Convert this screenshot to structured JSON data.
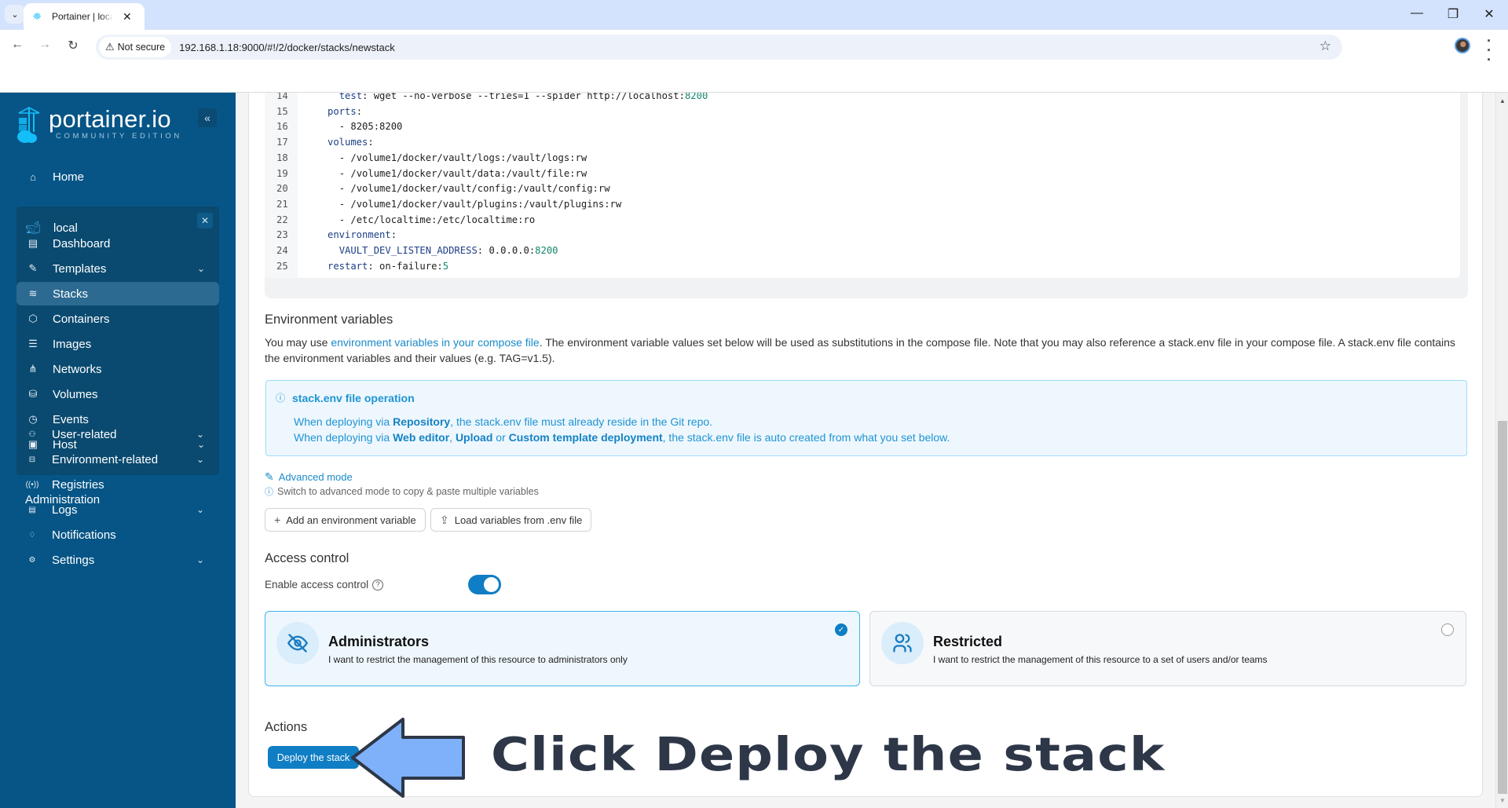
{
  "browser": {
    "tab_title": "Portainer | local",
    "security_label": "Not secure",
    "url": "192.168.1.18:9000/#!/2/docker/stacks/newstack"
  },
  "sidebar": {
    "logo_text": "portainer.io",
    "logo_subtext": "COMMUNITY EDITION",
    "home_label": "Home",
    "environment": {
      "name": "local",
      "items": [
        {
          "label": "Dashboard",
          "icon": "dashboard-icon",
          "glyph": "▤",
          "expandable": false
        },
        {
          "label": "Templates",
          "icon": "edit-icon",
          "glyph": "✎",
          "expandable": true
        },
        {
          "label": "Stacks",
          "icon": "layers-icon",
          "glyph": "≋",
          "expandable": false,
          "active": true
        },
        {
          "label": "Containers",
          "icon": "box-icon",
          "glyph": "⬡",
          "expandable": false
        },
        {
          "label": "Images",
          "icon": "list-icon",
          "glyph": "☰",
          "expandable": false
        },
        {
          "label": "Networks",
          "icon": "network-icon",
          "glyph": "⋔",
          "expandable": false
        },
        {
          "label": "Volumes",
          "icon": "database-icon",
          "glyph": "⛁",
          "expandable": false
        },
        {
          "label": "Events",
          "icon": "clock-icon",
          "glyph": "◷",
          "expandable": false
        },
        {
          "label": "Host",
          "icon": "host-icon",
          "glyph": "▣",
          "expandable": true
        }
      ]
    },
    "admin_heading": "Administration",
    "admin_items": [
      {
        "label": "User-related",
        "icon": "users-icon",
        "glyph": "⚇",
        "expandable": true
      },
      {
        "label": "Environment-related",
        "icon": "hard-drive-icon",
        "glyph": "⊟",
        "expandable": true
      },
      {
        "label": "Registries",
        "icon": "radio-icon",
        "glyph": "((•))",
        "expandable": false
      },
      {
        "label": "Logs",
        "icon": "file-text-icon",
        "glyph": "▤",
        "expandable": true
      },
      {
        "label": "Notifications",
        "icon": "bell-icon",
        "glyph": "♢",
        "expandable": false
      },
      {
        "label": "Settings",
        "icon": "gear-icon",
        "glyph": "⚙",
        "expandable": true
      }
    ]
  },
  "editor": {
    "lines": [
      {
        "n": "14",
        "indent": "  ",
        "parts": [
          [
            "k",
            "test"
          ],
          [
            "t",
            ": wget --no-verbose --tries=1 --spider http://localhost:"
          ],
          [
            "n",
            "8200"
          ]
        ]
      },
      {
        "n": "15",
        "indent": "",
        "parts": [
          [
            "k",
            "ports"
          ],
          [
            "t",
            ":"
          ]
        ]
      },
      {
        "n": "16",
        "indent": "  ",
        "parts": [
          [
            "t",
            "- 8205:8200"
          ]
        ]
      },
      {
        "n": "17",
        "indent": "",
        "parts": [
          [
            "k",
            "volumes"
          ],
          [
            "t",
            ":"
          ]
        ]
      },
      {
        "n": "18",
        "indent": "  ",
        "parts": [
          [
            "t",
            "- /volume1/docker/vault/logs:/vault/logs:rw"
          ]
        ]
      },
      {
        "n": "19",
        "indent": "  ",
        "parts": [
          [
            "t",
            "- /volume1/docker/vault/data:/vault/file:rw"
          ]
        ]
      },
      {
        "n": "20",
        "indent": "  ",
        "parts": [
          [
            "t",
            "- /volume1/docker/vault/config:/vault/config:rw"
          ]
        ]
      },
      {
        "n": "21",
        "indent": "  ",
        "parts": [
          [
            "t",
            "- /volume1/docker/vault/plugins:/vault/plugins:rw"
          ]
        ]
      },
      {
        "n": "22",
        "indent": "  ",
        "parts": [
          [
            "t",
            "- /etc/localtime:/etc/localtime:ro"
          ]
        ]
      },
      {
        "n": "23",
        "indent": "",
        "parts": [
          [
            "k",
            "environment"
          ],
          [
            "t",
            ":"
          ]
        ]
      },
      {
        "n": "24",
        "indent": "  ",
        "parts": [
          [
            "k",
            "VAULT_DEV_LISTEN_ADDRESS"
          ],
          [
            "t",
            ": 0.0.0.0:"
          ],
          [
            "n",
            "8200"
          ]
        ]
      },
      {
        "n": "25",
        "indent": "",
        "parts": [
          [
            "k",
            "restart"
          ],
          [
            "t",
            ": on-failure:"
          ],
          [
            "n",
            "5"
          ]
        ]
      }
    ]
  },
  "env_vars": {
    "title": "Environment variables",
    "desc_prefix": "You may use ",
    "desc_link": "environment variables in your compose file",
    "desc_suffix": ". The environment variable values set below will be used as substitutions in the compose file. Note that you may also reference a stack.env file in your compose file. A stack.env file contains the environment variables and their values (e.g. TAG=v1.5).",
    "info_title": "stack.env file operation",
    "info_line1": {
      "a": "When deploying via ",
      "b1": "Repository",
      "c": ", the stack.env file must already reside in the Git repo."
    },
    "info_line2": {
      "a": "When deploying via ",
      "b1": "Web editor",
      "c1": ", ",
      "b2": "Upload",
      "c2": " or ",
      "b3": "Custom template deployment",
      "c3": ", the stack.env file is auto created from what you set below."
    },
    "advanced_mode_label": "Advanced mode",
    "advanced_hint": "Switch to advanced mode to copy & paste multiple variables",
    "add_button": "Add an environment variable",
    "load_button": "Load variables from .env file"
  },
  "access_control": {
    "title": "Access control",
    "enable_label": "Enable access control",
    "enabled": true,
    "options": [
      {
        "title": "Administrators",
        "desc": "I want to restrict the management of this resource to administrators only",
        "selected": true
      },
      {
        "title": "Restricted",
        "desc": "I want to restrict the management of this resource to a set of users and/or teams",
        "selected": false
      }
    ]
  },
  "actions": {
    "title": "Actions",
    "deploy_button": "Deploy the stack"
  },
  "annotation": {
    "text": "Click Deploy the stack",
    "arrow_color": "#7fb1fb"
  }
}
